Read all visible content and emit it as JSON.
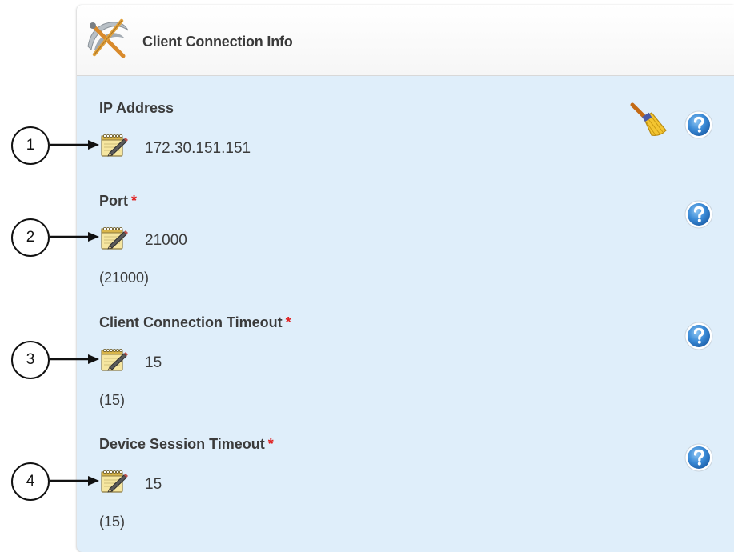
{
  "panel": {
    "title": "Client Connection Info",
    "title_icon": "tools-icon"
  },
  "toolbar": {
    "clear_icon": "broom-icon"
  },
  "fields": [
    {
      "label": "IP Address",
      "required": false,
      "value": "172.30.151.151",
      "default": "",
      "callout": "1"
    },
    {
      "label": "Port",
      "required": true,
      "required_mark": "*",
      "value": "21000",
      "default": "(21000)",
      "callout": "2"
    },
    {
      "label": "Client Connection Timeout",
      "required": true,
      "required_mark": "*",
      "value": "15",
      "default": "(15)",
      "callout": "3"
    },
    {
      "label": "Device Session Timeout",
      "required": true,
      "required_mark": "*",
      "value": "15",
      "default": "(15)",
      "callout": "4"
    }
  ],
  "icons": {
    "edit": "notepad-pencil-icon",
    "help": "question-mark-icon"
  },
  "colors": {
    "panel_background": "#dfeefa",
    "required_mark": "#e02020",
    "help_blue": "#2f7fd0"
  }
}
